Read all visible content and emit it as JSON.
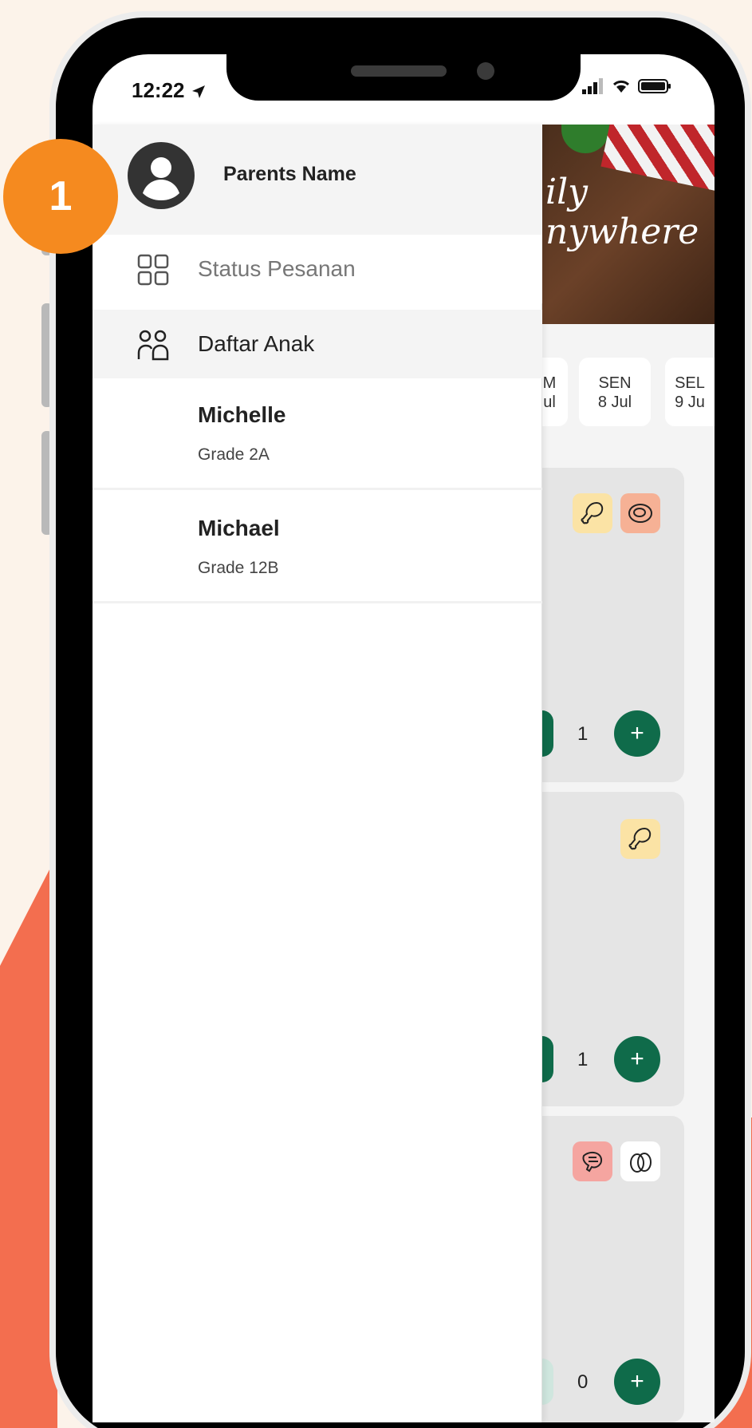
{
  "status_bar": {
    "time": "12:22"
  },
  "drawer": {
    "parent_name": "Parents Name",
    "menu": [
      {
        "label": "Status Pesanan",
        "icon": "grid-icon"
      },
      {
        "label": "Daftar Anak",
        "icon": "people-icon"
      }
    ],
    "children": [
      {
        "name": "Michelle",
        "grade": "Grade 2A"
      },
      {
        "name": "Michael",
        "grade": "Grade 12B"
      }
    ]
  },
  "background_app": {
    "banner_text": [
      "ily",
      "nywhere"
    ],
    "days": [
      {
        "day": "M",
        "date": "ul"
      },
      {
        "day": "SEN",
        "date": "8 Jul"
      },
      {
        "day": "SEL",
        "date": "9 Ju"
      }
    ],
    "cards": [
      {
        "qty": "1",
        "tags": [
          "chicken-icon",
          "meat-icon"
        ]
      },
      {
        "qty": "1",
        "tags": [
          "chicken-icon"
        ]
      },
      {
        "qty": "0",
        "tags": [
          "shrimp-icon",
          "egg-icon"
        ]
      }
    ],
    "plus_label": "+"
  },
  "step_badge": "1",
  "colors": {
    "accent_orange": "#f58a1f",
    "coral_bg": "#f36e4f",
    "green_button": "#0f6b4a",
    "cream_bg": "#fcf3ea"
  }
}
